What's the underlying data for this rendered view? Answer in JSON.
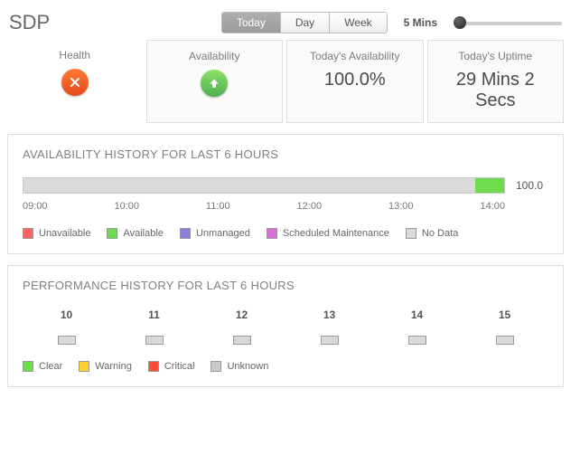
{
  "header": {
    "title": "SDP",
    "range_options": [
      "Today",
      "Day",
      "Week"
    ],
    "range_selected": "Today",
    "refresh_label": "5 Mins"
  },
  "stats": {
    "health": {
      "label": "Health"
    },
    "availability": {
      "label": "Availability"
    },
    "today_avail": {
      "label": "Today's Availability",
      "value": "100.0%"
    },
    "today_uptime": {
      "label": "Today's Uptime",
      "value": "29 Mins 2 Secs"
    }
  },
  "availability_panel": {
    "title": "AVAILABILITY HISTORY FOR LAST 6 HOURS",
    "value_label": "100.0",
    "axis": [
      "09:00",
      "10:00",
      "11:00",
      "12:00",
      "13:00",
      "14:00"
    ],
    "legend": [
      {
        "label": "Unavailable",
        "color": "#ff6262"
      },
      {
        "label": "Available",
        "color": "#6fdc4e"
      },
      {
        "label": "Unmanaged",
        "color": "#8a7bdc"
      },
      {
        "label": "Scheduled Maintenance",
        "color": "#d96fd9"
      },
      {
        "label": "No Data",
        "color": "#d9d9d9"
      }
    ]
  },
  "performance_panel": {
    "title": "PERFORMANCE HISTORY FOR LAST 6 HOURS",
    "hours": [
      "10",
      "11",
      "12",
      "13",
      "14",
      "15"
    ],
    "legend": [
      {
        "label": "Clear",
        "color": "#6fdc4e"
      },
      {
        "label": "Warning",
        "color": "#ffcf33"
      },
      {
        "label": "Critical",
        "color": "#ff4d33"
      },
      {
        "label": "Unknown",
        "color": "#c9c9c9"
      }
    ]
  },
  "chart_data": [
    {
      "type": "bar",
      "title": "Availability history for last 6 hours",
      "categories": [
        "09:00",
        "10:00",
        "11:00",
        "12:00",
        "13:00",
        "14:00"
      ],
      "series": [
        {
          "name": "No Data",
          "values": [
            100,
            100,
            100,
            100,
            100,
            60
          ]
        },
        {
          "name": "Available",
          "values": [
            0,
            0,
            0,
            0,
            0,
            40
          ]
        }
      ],
      "ylim": [
        0,
        100
      ],
      "overall_availability_pct": 100.0
    },
    {
      "type": "heatmap",
      "title": "Performance history for last 6 hours",
      "categories": [
        "10",
        "11",
        "12",
        "13",
        "14",
        "15"
      ],
      "values": [
        "Unknown",
        "Unknown",
        "Unknown",
        "Unknown",
        "Unknown",
        "Unknown"
      ]
    }
  ]
}
